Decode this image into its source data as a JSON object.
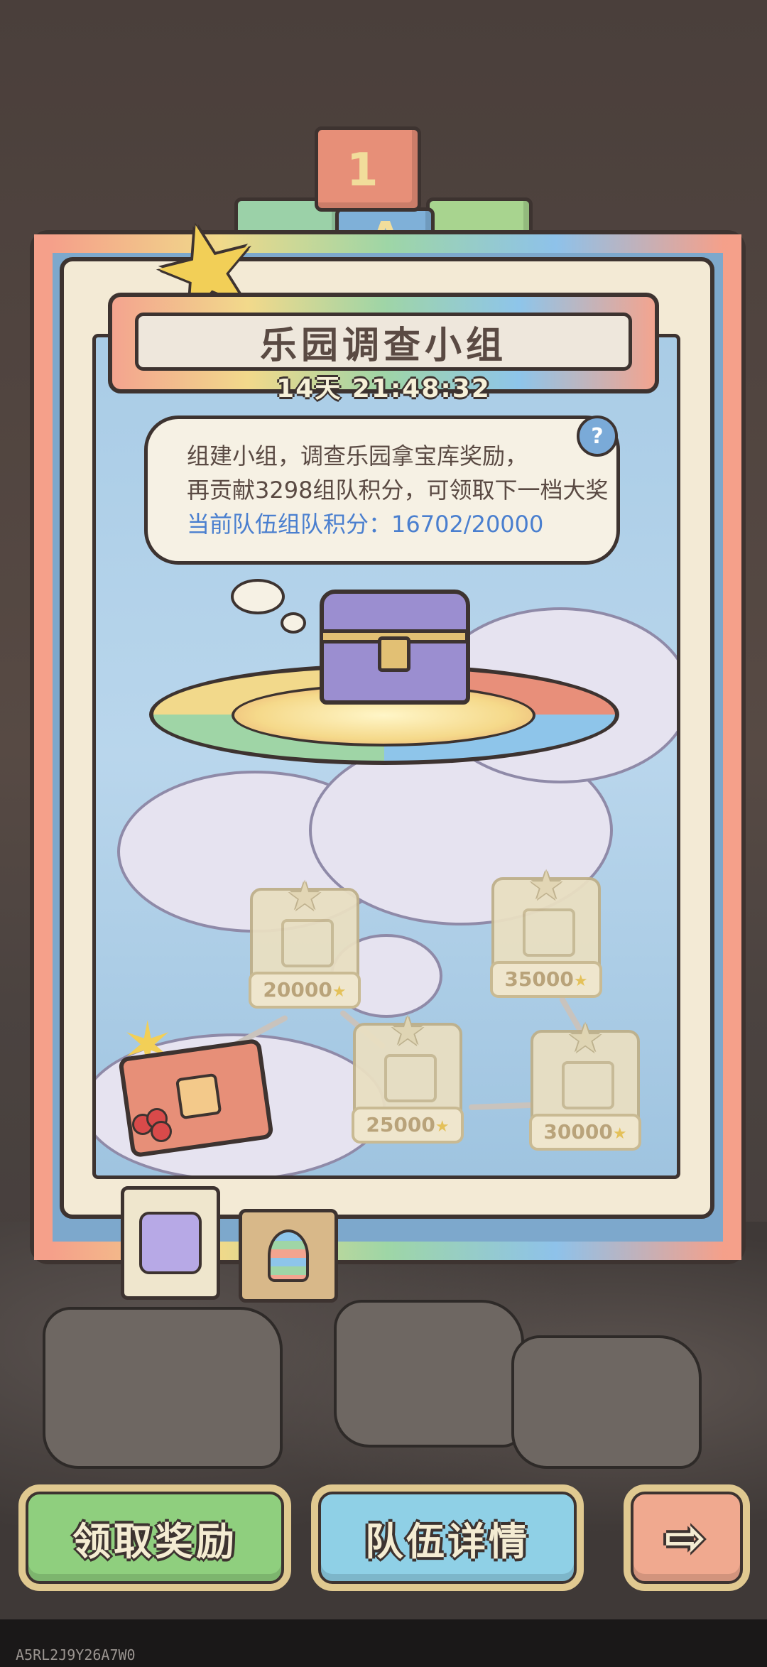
{
  "event": {
    "title": "乐园调查小组",
    "timer": "14天  21:48:32"
  },
  "info": {
    "line1": "组建小组，调查乐园拿宝库奖励，",
    "line2": "再贡献3298组队积分，可领取下一档大奖",
    "line3": "当前队伍组队积分：16702/20000",
    "help_icon": "?"
  },
  "decor": {
    "block_number": "1",
    "block_letter": "A"
  },
  "rewards": [
    {
      "points": "20000"
    },
    {
      "points": "35000"
    },
    {
      "points": "25000"
    },
    {
      "points": "30000"
    }
  ],
  "tabs": [
    "cloud-ring-icon",
    "stacked-rings-icon"
  ],
  "buttons": {
    "claim": "领取奖励",
    "team_details": "队伍详情",
    "next_arrow": "⇨"
  },
  "footer_code": "A5RL2J9Y26A7W0",
  "colors": {
    "claim_button": "#8fcf7e",
    "team_button": "#8fd0e6",
    "next_button": "#f0a98f",
    "score_text": "#4a7fcf"
  }
}
